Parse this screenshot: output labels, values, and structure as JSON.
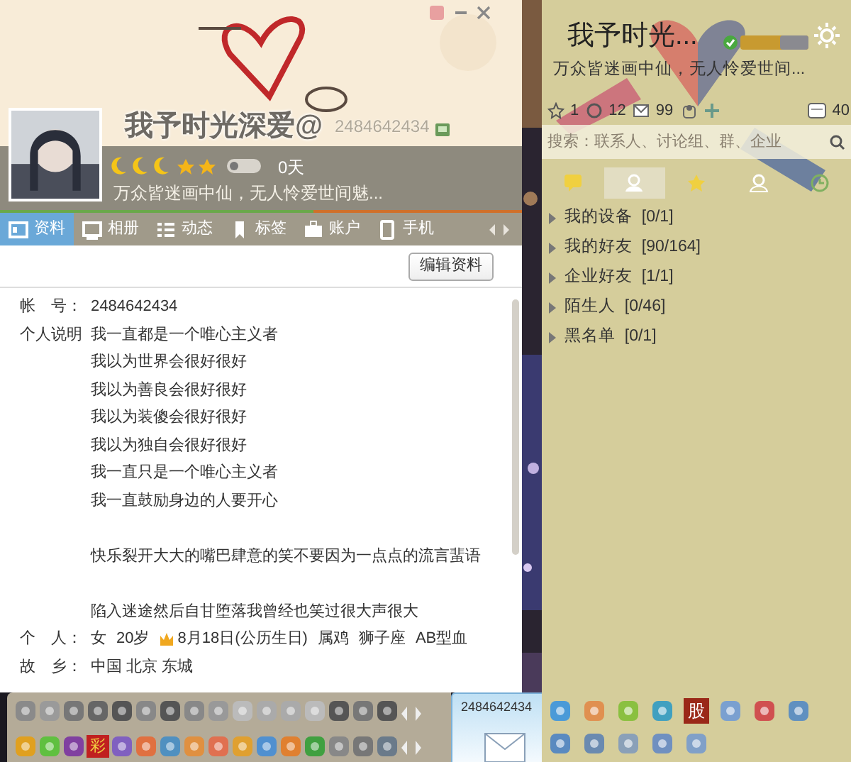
{
  "profile": {
    "name": "我予时光深爱@",
    "qq_number": "2484642434",
    "days": "0天",
    "signature": "万众皆迷画中仙，无人怜爱世间魅..."
  },
  "tabs": [
    {
      "label": "资料",
      "selected": true
    },
    {
      "label": "相册",
      "selected": false
    },
    {
      "label": "动态",
      "selected": false
    },
    {
      "label": "标签",
      "selected": false
    },
    {
      "label": "账户",
      "selected": false
    },
    {
      "label": "手机",
      "selected": false
    }
  ],
  "edit_button": "编辑资料",
  "fields": [
    {
      "kind": "values",
      "label": "帐　号：",
      "values": [
        "2484642434"
      ]
    },
    {
      "kind": "paragraphs",
      "label": "个人说明",
      "paragraphs": [
        [
          "我一直都是一个唯心主义者",
          "我以为世界会很好很好",
          "我以为善良会很好很好",
          "我以为装傻会很好很好",
          "我以为独自会很好很好",
          "我一直只是一个唯心主义者",
          "我一直鼓励身边的人要开心"
        ],
        [
          "快乐裂开大大的嘴巴肆意的笑不要因为一点点的流言蜚语"
        ],
        [
          "陷入迷途然后自甘堕落我曾经也笑过很大声很大"
        ]
      ]
    },
    {
      "kind": "values",
      "label": "个　人：",
      "values": [
        "女",
        "20岁",
        "8月18日(公历生日)",
        "属鸡",
        "狮子座",
        "AB型血"
      ]
    },
    {
      "kind": "values",
      "label": "故　乡：",
      "values": [
        "中国 北京 东城"
      ]
    }
  ],
  "app_bar": {
    "label_tile": "彩"
  },
  "mini_window": {
    "title": "2484642434"
  },
  "contacts": {
    "name": "我予时光...",
    "signature": "万众皆迷画中仙，无人怜爱世间...",
    "counts": [
      "1",
      "12",
      "99",
      "40"
    ],
    "search": {
      "placeholder": "搜索：联系人、讨论组、群、企业"
    },
    "tabs": [
      {
        "kind": "chat",
        "selected": false
      },
      {
        "kind": "contact",
        "selected": true
      },
      {
        "kind": "star",
        "selected": false
      },
      {
        "kind": "group",
        "selected": false
      },
      {
        "kind": "recent",
        "selected": false
      }
    ],
    "groups": [
      {
        "name": "我的设备",
        "count": "[0/1]"
      },
      {
        "name": "我的好友",
        "count": "[90/164]"
      },
      {
        "name": "企业好友",
        "count": "[1/1]"
      },
      {
        "name": "陌生人",
        "count": "[0/46]"
      },
      {
        "name": "黑名单",
        "count": "[0/1]"
      }
    ],
    "app_label_tile": "股"
  }
}
